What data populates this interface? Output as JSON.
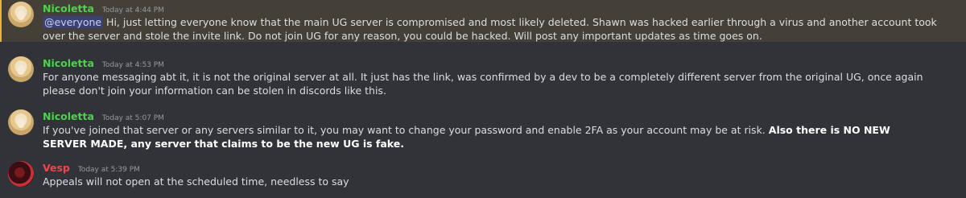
{
  "messages": [
    {
      "author": "Nicoletta",
      "timestamp": "Today at 4:44 PM",
      "mention": "@everyone",
      "text": " Hi, just letting everyone know that the main UG server is compromised and most likely deleted. Shawn was hacked earlier through a virus and another account took over the server and stole the invite link. Do not join UG for any reason, you could be hacked. Will post any important updates as time goes on."
    },
    {
      "author": "Nicoletta",
      "timestamp": "Today at 4:53 PM",
      "text": "For anyone messaging abt it, it is not the original server at all. It just has the link, was confirmed by a dev to be a completely different server from the original UG, once again please don't join your information can be stolen in discords like this."
    },
    {
      "author": "Nicoletta",
      "timestamp": "Today at 5:07 PM",
      "text": "If you've joined that server or any servers similar to it, you may want to change your password and enable 2FA as your account may be at risk. ",
      "bold_text": "Also there is NO NEW SERVER MADE, any server that claims to be the new UG is fake."
    },
    {
      "author": "Vesp",
      "timestamp": "Today at 5:39 PM",
      "text": "Appeals will not open at the scheduled time, needless to say"
    }
  ],
  "colors": {
    "background": "#313338",
    "mention_highlight": "#444037",
    "mention_bar": "#f0b232",
    "nicoletta_name": "#4fd14f",
    "vesp_name": "#f0454c",
    "timestamp": "#949ba4"
  }
}
